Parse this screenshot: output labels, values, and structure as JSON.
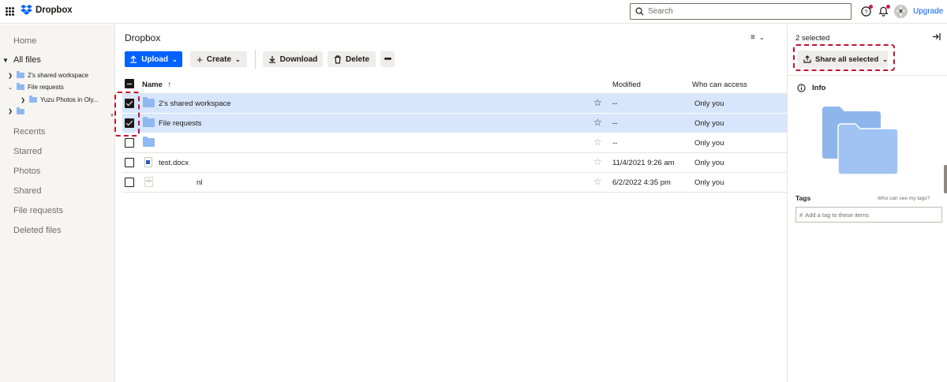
{
  "app": {
    "name": "Dropbox",
    "upgrade_label": "Upgrade",
    "brand_color": "#0061fe"
  },
  "search": {
    "placeholder": "Search"
  },
  "sidebar": {
    "items": [
      {
        "label": "Home"
      },
      {
        "label": "All files"
      },
      {
        "label": "Recents"
      },
      {
        "label": "Starred"
      },
      {
        "label": "Photos"
      },
      {
        "label": "Shared"
      },
      {
        "label": "File requests"
      },
      {
        "label": "Deleted files"
      }
    ],
    "tree": [
      {
        "label": "2's shared workspace"
      },
      {
        "label": "File requests"
      },
      {
        "label": "Yuzu Photos in Oly..."
      },
      {
        "label": ""
      }
    ]
  },
  "main": {
    "title": "Dropbox",
    "toolbar": {
      "upload": "Upload",
      "create": "Create",
      "download": "Download",
      "delete": "Delete"
    },
    "columns": {
      "name": "Name",
      "modified": "Modified",
      "access": "Who can access"
    },
    "rows": [
      {
        "name": "2's shared workspace",
        "modified": "--",
        "access": "Only you",
        "selected": true,
        "type": "folder"
      },
      {
        "name": "File requests",
        "modified": "--",
        "access": "Only you",
        "selected": true,
        "type": "folder"
      },
      {
        "name": "",
        "modified": "--",
        "access": "Only you",
        "selected": false,
        "type": "folder"
      },
      {
        "name": "test.docx",
        "modified": "11/4/2021 9:26 am",
        "access": "Only you",
        "selected": false,
        "type": "docx"
      },
      {
        "name": "nl",
        "modified": "6/2/2022 4:35 pm",
        "access": "Only you",
        "selected": false,
        "type": "code"
      }
    ]
  },
  "panel": {
    "selected_count": "2 selected",
    "share_label": "Share all selected",
    "info_label": "Info",
    "tags_label": "Tags",
    "tags_help": "Who can see my tags?",
    "tags_placeholder": "Add a tag to these items"
  },
  "colors": {
    "selection_bg": "#d7e6fc",
    "highlight": "#c8102e",
    "folder": "#90b9f0"
  }
}
